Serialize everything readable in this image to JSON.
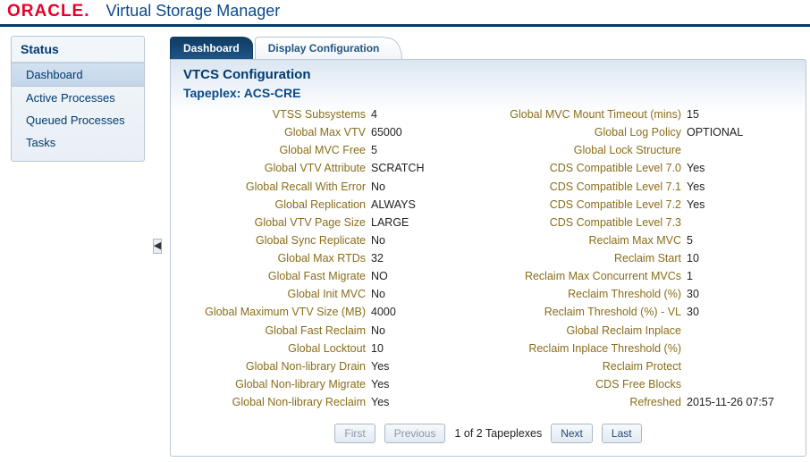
{
  "brand": "ORACLE",
  "app_title": "Virtual Storage Manager",
  "sidebar": {
    "title": "Status",
    "items": [
      {
        "label": "Dashboard",
        "selected": true
      },
      {
        "label": "Active Processes",
        "selected": false
      },
      {
        "label": "Queued Processes",
        "selected": false
      },
      {
        "label": "Tasks",
        "selected": false
      }
    ]
  },
  "tabs": [
    {
      "label": "Dashboard",
      "active": true
    },
    {
      "label": "Display Configuration",
      "active": false
    }
  ],
  "panel_title": "VTCS Configuration",
  "tapeplex_prefix": "Tapeplex: ",
  "tapeplex_name": "ACS-CRE",
  "config_left": [
    {
      "label": "VTSS Subsystems",
      "value": "4"
    },
    {
      "label": "Global Max VTV",
      "value": "65000"
    },
    {
      "label": "Global MVC Free",
      "value": "5"
    },
    {
      "label": "Global VTV Attribute",
      "value": "SCRATCH"
    },
    {
      "label": "Global Recall With Error",
      "value": "No"
    },
    {
      "label": "Global Replication",
      "value": "ALWAYS"
    },
    {
      "label": "Global VTV Page Size",
      "value": "LARGE"
    },
    {
      "label": "Global Sync Replicate",
      "value": "No"
    },
    {
      "label": "Global Max RTDs",
      "value": "32"
    },
    {
      "label": "Global Fast Migrate",
      "value": "NO"
    },
    {
      "label": "Global Init MVC",
      "value": "No"
    },
    {
      "label": "Global Maximum VTV Size (MB)",
      "value": "4000"
    },
    {
      "label": "Global Fast Reclaim",
      "value": "No"
    },
    {
      "label": "Global Locktout",
      "value": "10"
    },
    {
      "label": "Global Non-library Drain",
      "value": "Yes"
    },
    {
      "label": "Global Non-library Migrate",
      "value": "Yes"
    },
    {
      "label": "Global Non-library Reclaim",
      "value": "Yes"
    }
  ],
  "config_right": [
    {
      "label": "Global MVC Mount Timeout (mins)",
      "value": "15"
    },
    {
      "label": "Global Log Policy",
      "value": "OPTIONAL"
    },
    {
      "label": "Global Lock Structure",
      "value": ""
    },
    {
      "label": "CDS Compatible Level 7.0",
      "value": "Yes"
    },
    {
      "label": "CDS Compatible Level 7.1",
      "value": "Yes"
    },
    {
      "label": "CDS Compatible Level 7.2",
      "value": "Yes"
    },
    {
      "label": "CDS Compatible Level 7.3",
      "value": ""
    },
    {
      "label": "Reclaim Max MVC",
      "value": "5"
    },
    {
      "label": "Reclaim Start",
      "value": "10"
    },
    {
      "label": "Reclaim Max Concurrent MVCs",
      "value": "1"
    },
    {
      "label": "Reclaim Threshold (%)",
      "value": "30"
    },
    {
      "label": "Reclaim Threshold (%) - VL",
      "value": "30"
    },
    {
      "label": "Global Reclaim Inplace",
      "value": ""
    },
    {
      "label": "Reclaim Inplace Threshold (%)",
      "value": ""
    },
    {
      "label": "Reclaim Protect",
      "value": ""
    },
    {
      "label": "CDS Free Blocks",
      "value": ""
    },
    {
      "label": "Refreshed",
      "value": "2015-11-26 07:57"
    }
  ],
  "pager": {
    "first": "First",
    "previous": "Previous",
    "status": "1 of 2 Tapeplexes",
    "next": "Next",
    "last": "Last"
  }
}
